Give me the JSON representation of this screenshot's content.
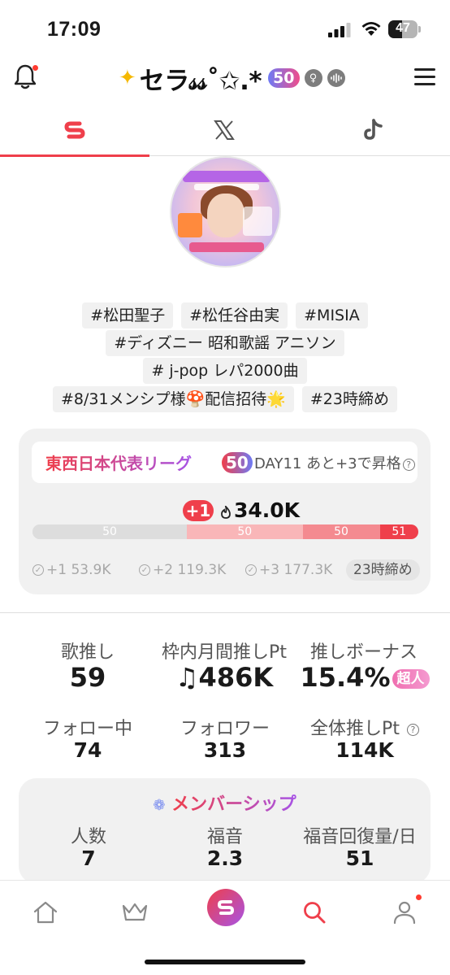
{
  "status_bar": {
    "time": "17:09",
    "battery": "47",
    "battery_level": 0.47
  },
  "header": {
    "title": "セラ𝓈𝓈˚✩.*",
    "level": "50",
    "icons": [
      "bell-icon",
      "star-icon",
      "female-icon",
      "voice-icon",
      "hamburger-menu-icon"
    ]
  },
  "tabs": [
    {
      "name": "tab-streaming",
      "icon": "stream-logo-icon",
      "active": true
    },
    {
      "name": "tab-x",
      "icon": "x-logo-icon",
      "active": false
    },
    {
      "name": "tab-tiktok",
      "icon": "tiktok-logo-icon",
      "active": false
    }
  ],
  "hashtags": {
    "row1": [
      "#松田聖子",
      "#松任谷由実",
      "#MISIA"
    ],
    "row2": [
      "#ディズニー 昭和歌謡 アニソン"
    ],
    "row3": [
      "#  j-pop レパ2000曲"
    ],
    "row4": [
      "#8/31メンシプ様🍄配信招待🌟",
      "#23時締め"
    ]
  },
  "league": {
    "name": "東西日本代表リーグ",
    "level": "50",
    "day_text": "DAY11 あと+3で昇格",
    "gain": "+1",
    "points": "34.0K",
    "segments": [
      {
        "label": "50",
        "fraction": 0.4,
        "color": "#dddddd"
      },
      {
        "label": "50",
        "fraction": 0.3,
        "color": "#f9b6b8"
      },
      {
        "label": "50",
        "fraction": 0.2,
        "color": "#f48a90"
      },
      {
        "label": "51",
        "fraction": 0.1,
        "color": "#ef3f4b"
      }
    ],
    "thresholds": [
      "+1 53.9K",
      "+2 119.3K",
      "+3 177.3K"
    ],
    "deadline": "23時締め"
  },
  "stats": {
    "song_push": {
      "label": "歌推し",
      "value": "59"
    },
    "monthly_pt": {
      "label": "枠内月間推しPt",
      "value": "♫486K"
    },
    "bonus": {
      "label": "推しボーナス",
      "value": "15.4%",
      "badge": "超人"
    },
    "following": {
      "label": "フォロー中",
      "value": "74"
    },
    "followers": {
      "label": "フォロワー",
      "value": "313"
    },
    "total_pt": {
      "label": "全体推しPt",
      "value": "114K"
    }
  },
  "membership": {
    "title": "メンバーシップ",
    "members": {
      "label": "人数",
      "value": "7"
    },
    "gospel": {
      "label": "福音",
      "value": "2.3"
    },
    "recovery": {
      "label": "福音回復量/日",
      "value": "51"
    }
  },
  "bottom_nav": [
    "home-icon",
    "crown-icon",
    "stream-logo-icon",
    "search-icon",
    "profile-icon"
  ],
  "colors": {
    "accent": "#ef3f4b",
    "purple": "#a754e6",
    "blue": "#6e7bf5"
  }
}
